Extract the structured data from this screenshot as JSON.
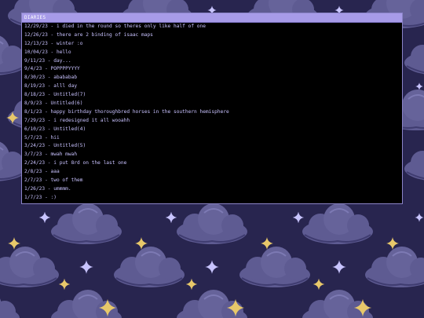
{
  "panel": {
    "title": "DIARIES"
  },
  "entries": [
    "12/29/23 - i died in the round so theres only like half of one",
    "12/26/23 - there are 2 binding of isaac maps",
    "12/13/23 - winter :o",
    "10/04/23 - hello",
    "9/11/23 - day...",
    "9/4/23 - POPPPPYYYY",
    "8/30/23 - abababab",
    "8/19/23 - alll day",
    "8/18/23 - Untitled(7)",
    "8/9/23 - Untitled(6)",
    "8/1/23 - happy birthday thoroughbred horses in the southern hemisphere",
    "7/29/23 - i redesigned it all wooahh",
    "6/10/23 - Untitled(4)",
    "5/7/23 - hii",
    "3/24/23 - Untitled(5)",
    "3/7/23 - mwah mwah",
    "2/24/23 - i put 8rd on the last one",
    "2/8/23 - aaa",
    "2/7/23 - two of them",
    "1/26/23 - ummmm.",
    "1/7/23 - :)"
  ],
  "colors": {
    "background": "#28254f",
    "cloud": "#5b5a8e",
    "star_gold": "#e8c86a",
    "star_lilac": "#c8c4ff",
    "panel_header": "#a79be8",
    "entry_text": "#c9c2ff"
  }
}
